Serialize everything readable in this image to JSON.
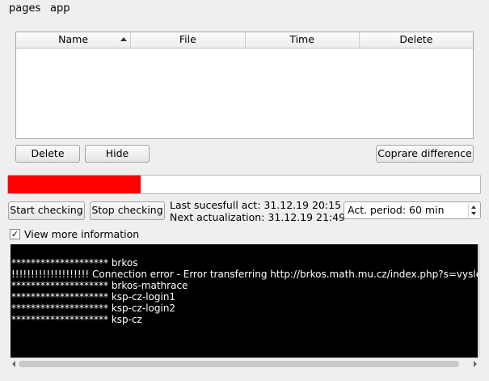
{
  "menu": {
    "pages": "pages",
    "app": "app"
  },
  "table": {
    "columns": [
      "Name",
      "File",
      "Time",
      "Delete"
    ],
    "sorted_column": "Name",
    "rows": []
  },
  "buttons": {
    "delete": "Delete",
    "hide": "Hide",
    "compare": "Coprare difference",
    "start": "Start checking",
    "stop": "Stop checking"
  },
  "progress": {
    "value": 0.28,
    "color": "#ff0000"
  },
  "status": {
    "last_act": "Last sucesfull act: 31.12.19 20:15",
    "next_act": "Next actualization: 31.12.19 21:49"
  },
  "period": {
    "value": "Act. period: 60 min"
  },
  "view_more": {
    "label": "View more information",
    "checked": true,
    "mark": "✓"
  },
  "console": {
    "lines": [
      "******************** brkos",
      "!!!!!!!!!!!!!!!!!!!! Connection error - Error transferring http://brkos.math.mu.cz/index.php?s=vysle",
      "******************** brkos-mathrace",
      "******************** ksp-cz-login1",
      "******************** ksp-cz-login2",
      "******************** ksp-cz"
    ]
  }
}
